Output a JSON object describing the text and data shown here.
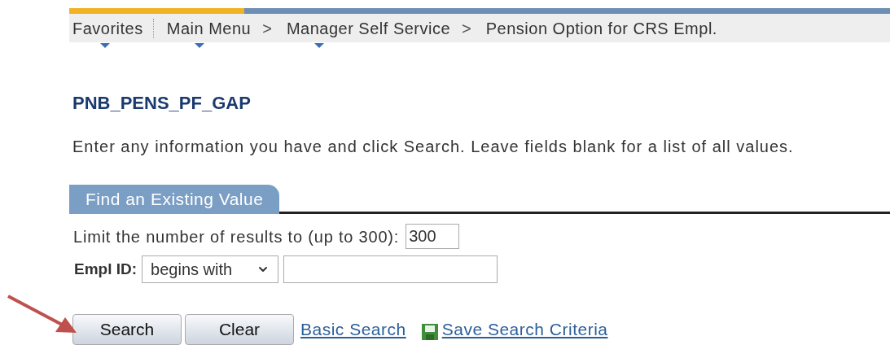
{
  "breadcrumbs": [
    {
      "label": "Favorites",
      "has_menu": true
    },
    {
      "label": "Main Menu",
      "has_menu": true
    },
    {
      "label": "Manager Self Service",
      "separator": ">",
      "has_menu": true
    },
    {
      "label": "Pension Option for CRS Empl.",
      "separator": ">",
      "has_menu": false
    }
  ],
  "page_title": "PNB_PENS_PF_GAP",
  "instructions": "Enter any information you have and click Search. Leave fields blank for a list of all values.",
  "tabs": [
    {
      "label": "Find an Existing Value",
      "selected": true
    }
  ],
  "limit": {
    "label": "Limit the number of results to (up to 300):",
    "value": "300"
  },
  "empl_id": {
    "label": "Empl ID:",
    "operator": "begins with"
  },
  "buttons": [
    "Search",
    "Clear"
  ],
  "links": [
    {
      "label": "Basic Search",
      "icon": false
    },
    {
      "label": "Save Search Criteria",
      "icon": true
    }
  ]
}
